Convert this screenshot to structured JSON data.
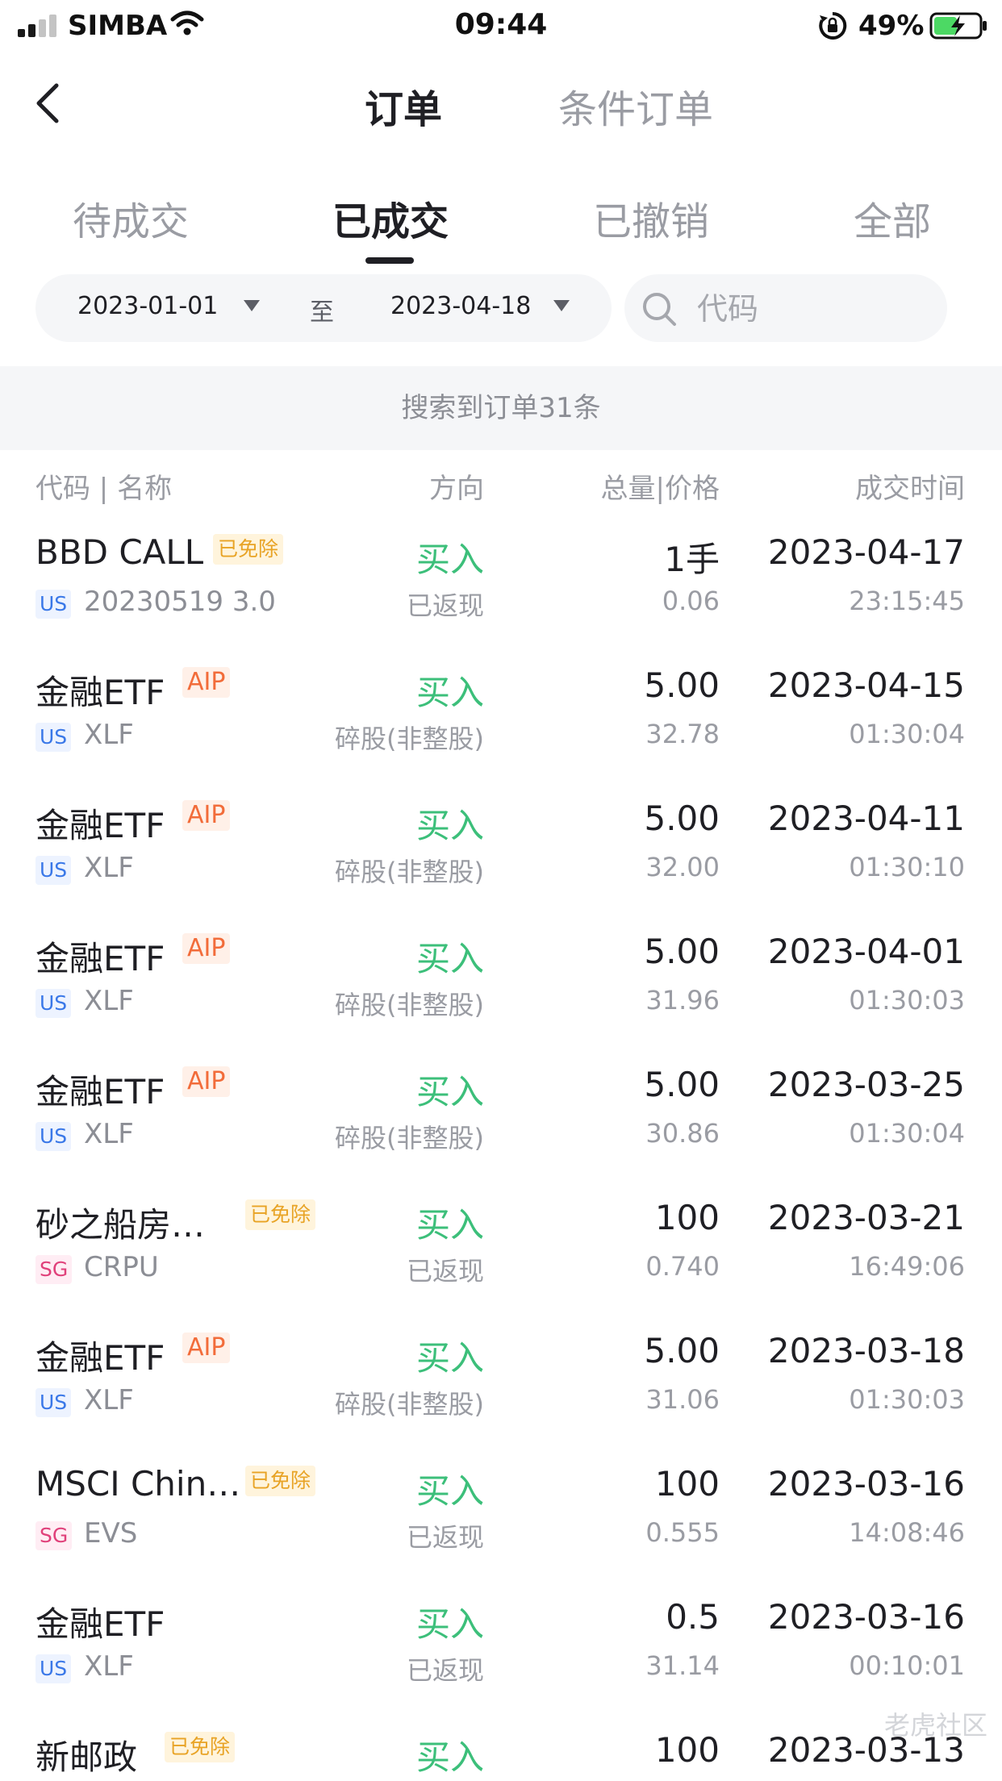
{
  "status_bar": {
    "carrier": "SIMBA",
    "time": "09:44",
    "battery": "49%"
  },
  "nav": {
    "tabs": [
      {
        "label": "订单",
        "active": true
      },
      {
        "label": "条件订单",
        "active": false
      }
    ]
  },
  "status_tabs": [
    {
      "label": "待成交",
      "active": false
    },
    {
      "label": "已成交",
      "active": true
    },
    {
      "label": "已撤销",
      "active": false
    },
    {
      "label": "全部",
      "active": false
    }
  ],
  "filter": {
    "start_date": "2023-01-01",
    "separator": "至",
    "end_date": "2023-04-18",
    "search_placeholder": "代码"
  },
  "summary": "搜索到订单31条",
  "columns": [
    "代码 | 名称",
    "方向",
    "总量|价格",
    "成交时间"
  ],
  "orders": [
    {
      "name": "BBD CALL",
      "badge": "已免除",
      "badge_type": "waived",
      "market": "US",
      "code": "20230519 3.0",
      "direction": "买入",
      "note": "已返现",
      "qty": "1手",
      "price": "0.06",
      "date": "2023-04-17",
      "time": "23:15:45"
    },
    {
      "name": "金融ETF",
      "badge": "AIP",
      "badge_type": "aip",
      "market": "US",
      "code": "XLF",
      "direction": "买入",
      "note": "碎股(非整股)",
      "qty": "5.00",
      "price": "32.78",
      "date": "2023-04-15",
      "time": "01:30:04"
    },
    {
      "name": "金融ETF",
      "badge": "AIP",
      "badge_type": "aip",
      "market": "US",
      "code": "XLF",
      "direction": "买入",
      "note": "碎股(非整股)",
      "qty": "5.00",
      "price": "32.00",
      "date": "2023-04-11",
      "time": "01:30:10"
    },
    {
      "name": "金融ETF",
      "badge": "AIP",
      "badge_type": "aip",
      "market": "US",
      "code": "XLF",
      "direction": "买入",
      "note": "碎股(非整股)",
      "qty": "5.00",
      "price": "31.96",
      "date": "2023-04-01",
      "time": "01:30:03"
    },
    {
      "name": "金融ETF",
      "badge": "AIP",
      "badge_type": "aip",
      "market": "US",
      "code": "XLF",
      "direction": "买入",
      "note": "碎股(非整股)",
      "qty": "5.00",
      "price": "30.86",
      "date": "2023-03-25",
      "time": "01:30:04"
    },
    {
      "name": "砂之船房…",
      "badge": "已免除",
      "badge_type": "waived",
      "market": "SG",
      "code": "CRPU",
      "direction": "买入",
      "note": "已返现",
      "qty": "100",
      "price": "0.740",
      "date": "2023-03-21",
      "time": "16:49:06"
    },
    {
      "name": "金融ETF",
      "badge": "AIP",
      "badge_type": "aip",
      "market": "US",
      "code": "XLF",
      "direction": "买入",
      "note": "碎股(非整股)",
      "qty": "5.00",
      "price": "31.06",
      "date": "2023-03-18",
      "time": "01:30:03"
    },
    {
      "name": "MSCI Chin…",
      "badge": "已免除",
      "badge_type": "waived",
      "market": "SG",
      "code": "EVS",
      "direction": "买入",
      "note": "已返现",
      "qty": "100",
      "price": "0.555",
      "date": "2023-03-16",
      "time": "14:08:46"
    },
    {
      "name": "金融ETF",
      "badge": "",
      "badge_type": "",
      "market": "US",
      "code": "XLF",
      "direction": "买入",
      "note": "已返现",
      "qty": "0.5",
      "price": "31.14",
      "date": "2023-03-16",
      "time": "00:10:01"
    },
    {
      "name": "新邮政",
      "badge": "已免除",
      "badge_type": "waived",
      "market": "",
      "code": "",
      "direction": "买入",
      "note": "",
      "qty": "100",
      "price": "",
      "date": "2023-03-13",
      "time": ""
    }
  ],
  "watermark": "老虎社区",
  "icons": {
    "back": "chevron-left-icon",
    "search": "search-icon",
    "caret": "triangle-down-icon"
  },
  "colors": {
    "buy_green": "#3cbf7a",
    "waived_badge": "#e8a325",
    "aip_badge": "#f26c3a",
    "us_tag": "#3a78e8",
    "sg_tag": "#e0407a"
  }
}
